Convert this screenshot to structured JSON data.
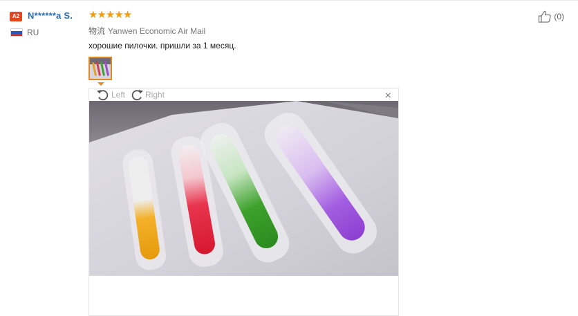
{
  "review": {
    "badge": "A2",
    "username": "N******a S.",
    "country": "RU",
    "rating_stars": 5,
    "star_glyph": "★",
    "helpful_count": "(0)",
    "shipping_label": "物流",
    "shipping_method": "Yanwen Economic Air Mail",
    "text": "хорошие пилочки. пришли за 1 месяц."
  },
  "viewer": {
    "rotate_left_label": "Left",
    "rotate_right_label": "Right",
    "close_label": "×"
  },
  "colors": {
    "accent": "#e28a20",
    "username": "#2a6eb8",
    "badge": "#e0461f",
    "star": "#f39c12"
  },
  "icons": {
    "helpful": "thumbs-up-icon",
    "rotate_left": "rotate-left-icon",
    "rotate_right": "rotate-right-icon",
    "close": "close-icon",
    "flag": "russia-flag-icon"
  }
}
